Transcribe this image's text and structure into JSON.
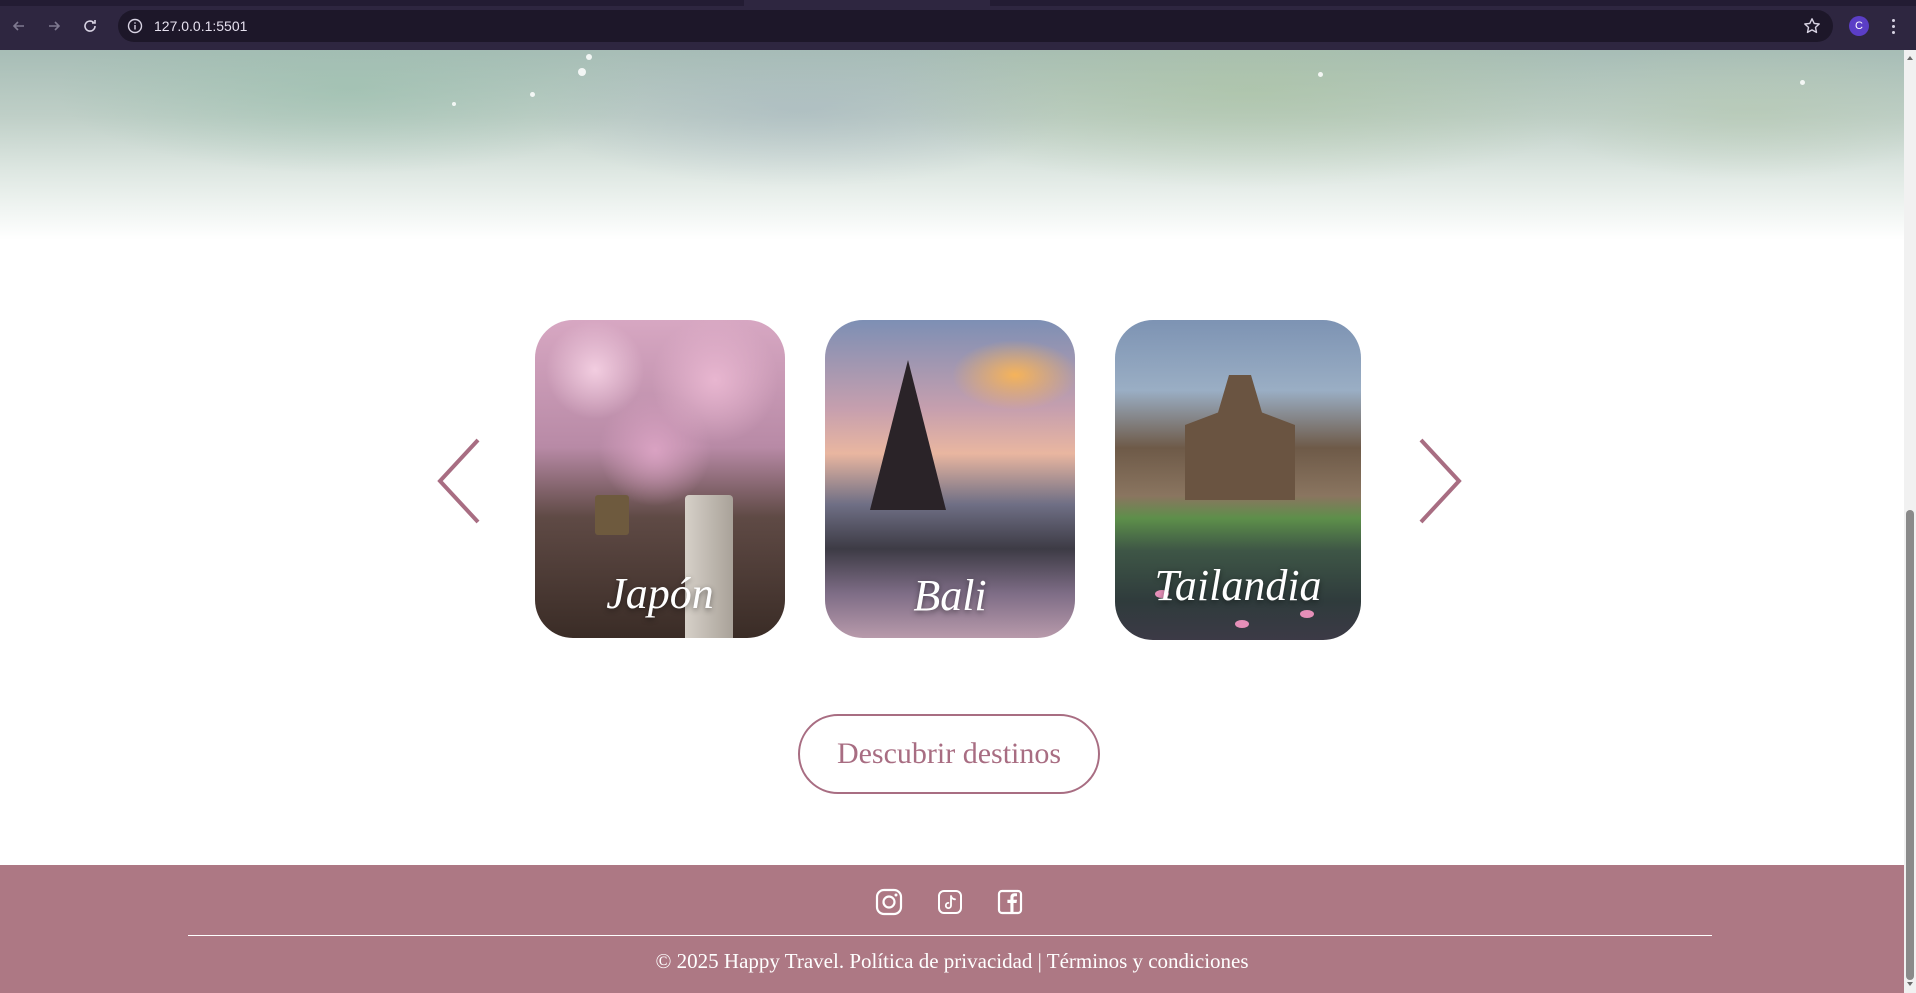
{
  "browser": {
    "url": "127.0.0.1:5501",
    "profile_initial": "C",
    "icons": [
      "back-icon",
      "forward-icon",
      "reload-icon",
      "info-icon",
      "star-icon",
      "kebab-menu-icon"
    ]
  },
  "carousel": {
    "prev_icon": "chevron-left-icon",
    "next_icon": "chevron-right-icon",
    "arrow_color": "#a86d82",
    "cards": [
      {
        "label": "Japón"
      },
      {
        "label": "Bali"
      },
      {
        "label": "Tailandia"
      }
    ]
  },
  "cta": {
    "label": "Descubrir destinos",
    "color": "#a86d82"
  },
  "footer": {
    "background": "#ad7884",
    "social_icons": [
      "instagram-icon",
      "tiktok-icon",
      "facebook-icon"
    ],
    "copyright": "© 2025 Happy Travel. Política de privacidad | Términos y condiciones"
  }
}
